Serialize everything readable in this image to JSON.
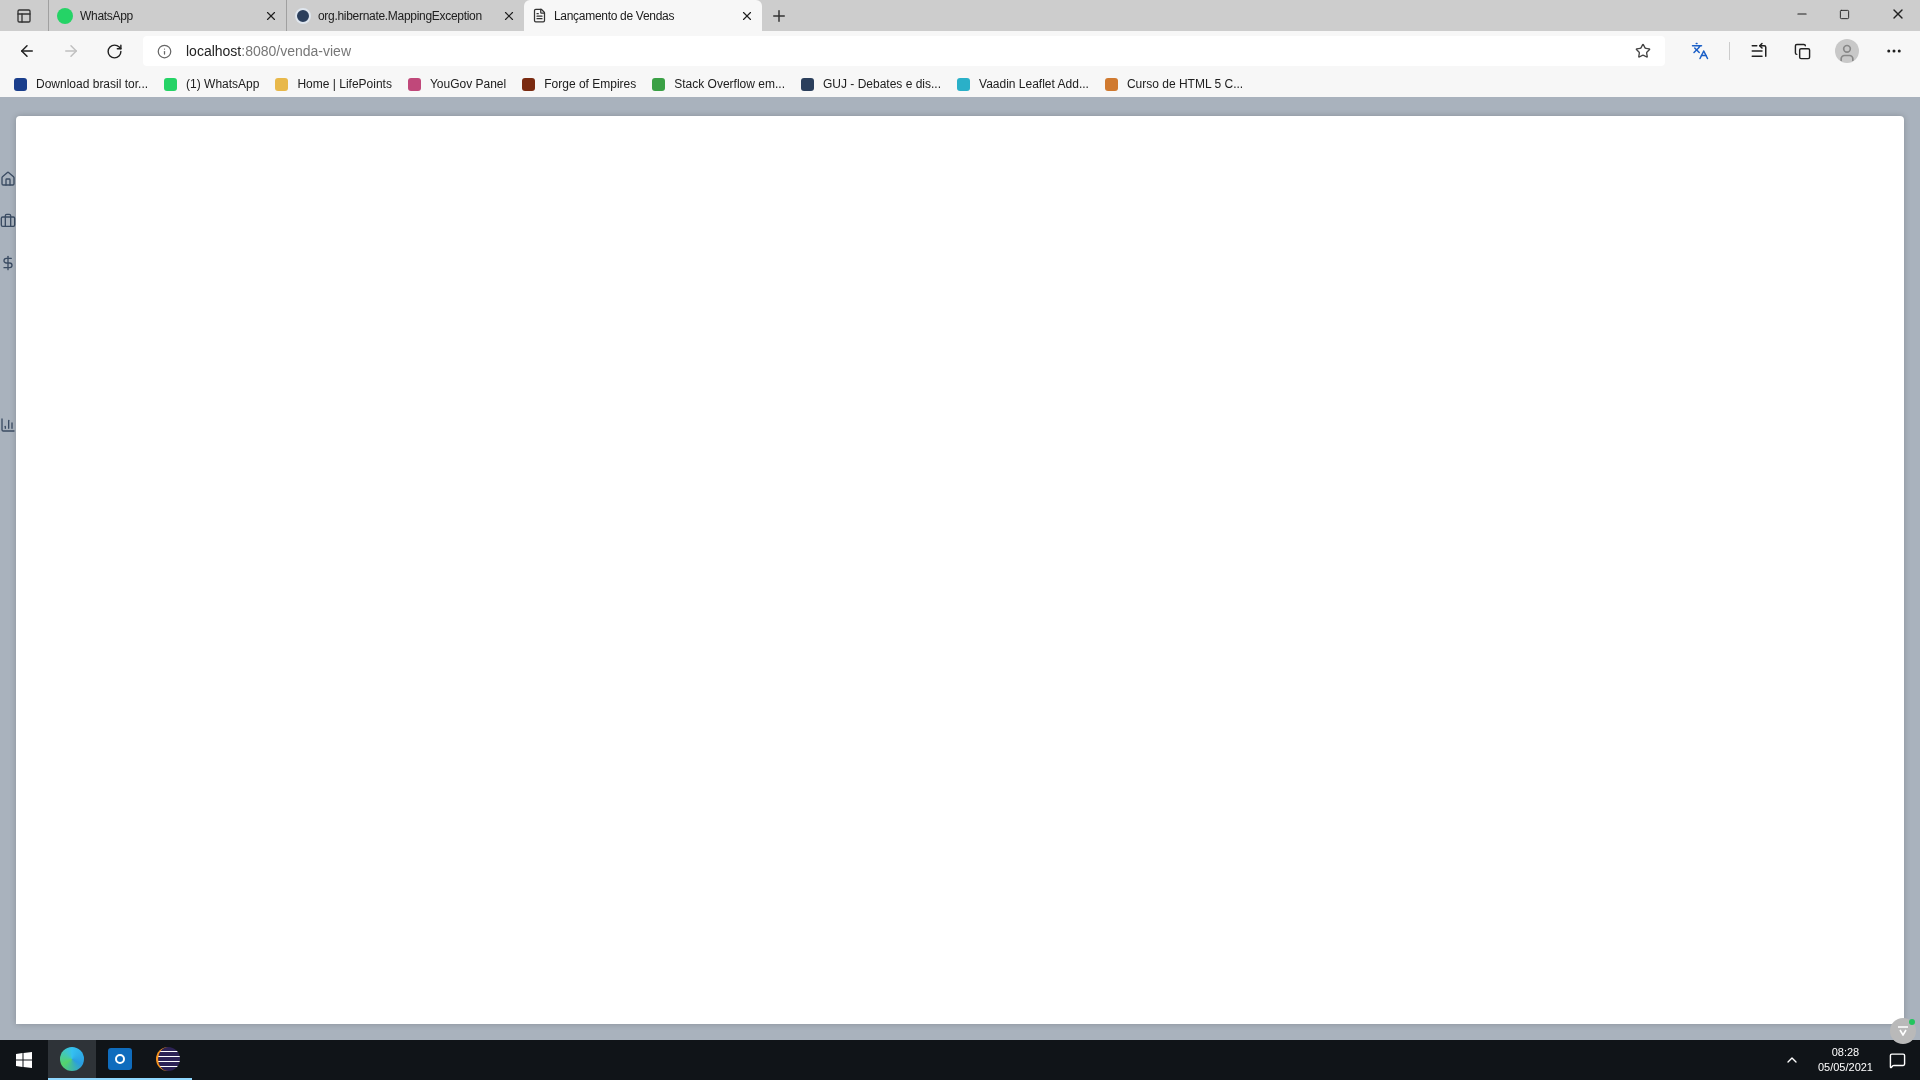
{
  "tabs": [
    {
      "label": "WhatsApp",
      "selected": false
    },
    {
      "label": "org.hibernate.MappingException",
      "selected": false
    },
    {
      "label": "Lançamento de Vendas",
      "selected": true
    }
  ],
  "address_bar": {
    "host": "localhost",
    "path": ":8080/venda-view"
  },
  "bookmarks": [
    "Download brasil tor...",
    "(1) WhatsApp",
    "Home | LifePoints",
    "YouGov Panel",
    "Forge of Empires",
    "Stack Overflow em...",
    "GUJ - Debates e dis...",
    "Vaadin Leaflet Add...",
    "Curso de HTML 5 C..."
  ],
  "taskbar": {
    "apps": [
      {
        "selected": true
      },
      {
        "selected": false
      },
      {
        "selected": false
      }
    ],
    "time": "08:28",
    "date": "05/05/2021"
  }
}
